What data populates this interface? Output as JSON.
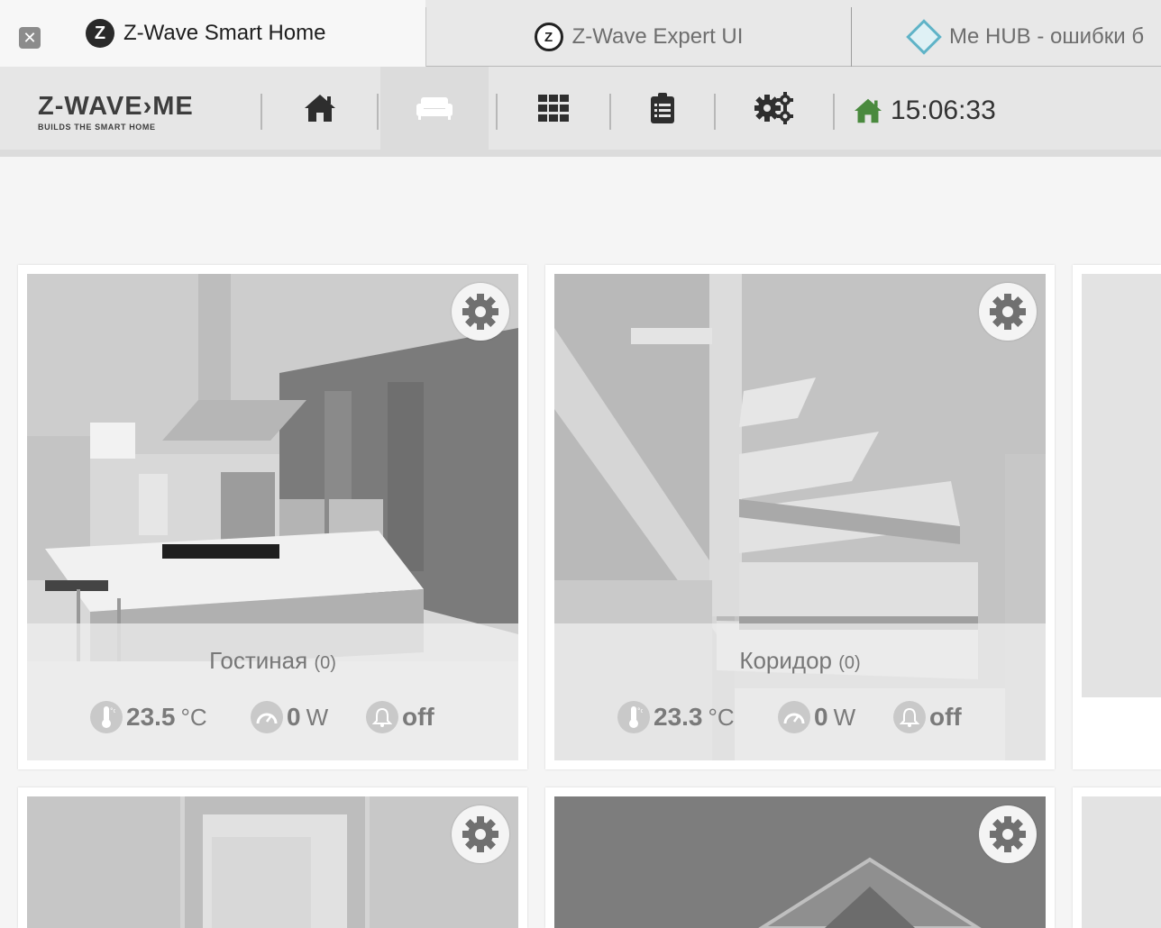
{
  "browser": {
    "tabs": [
      {
        "title": "Z-Wave Smart Home",
        "icon": "zwave-icon",
        "active": true
      },
      {
        "title": "Z-Wave Expert UI",
        "icon": "zwave-icon",
        "active": false
      },
      {
        "title": "Me HUB - ошибки б",
        "icon": "hub-icon",
        "active": false
      }
    ],
    "close_glyph": "✕"
  },
  "nav": {
    "brand_main": "Z-WAVE›ME",
    "brand_sub": "BUILDS THE SMART HOME",
    "items": [
      {
        "icon": "home-icon",
        "active": false
      },
      {
        "icon": "sofa-icon",
        "active": true
      },
      {
        "icon": "grid-icon",
        "active": false
      },
      {
        "icon": "clipboard-icon",
        "active": false
      },
      {
        "icon": "gears-icon",
        "active": false
      }
    ],
    "time": "15:06:33",
    "status_color": "#4a8a3e"
  },
  "rooms": [
    {
      "name": "Гостиная",
      "count": "(0)",
      "temp": "23.5",
      "temp_unit": "°C",
      "power": "0",
      "power_unit": "W",
      "alarm": "off"
    },
    {
      "name": "Коридор",
      "count": "(0)",
      "temp": "23.3",
      "temp_unit": "°C",
      "power": "0",
      "power_unit": "W",
      "alarm": "off"
    }
  ]
}
